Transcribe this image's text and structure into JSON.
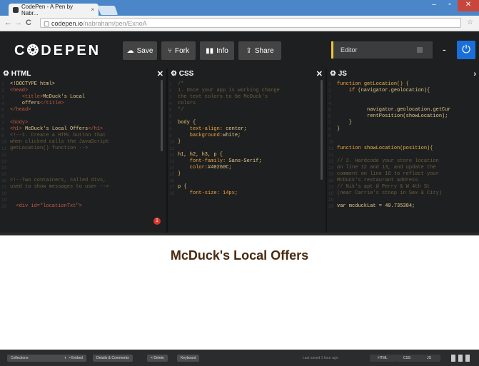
{
  "browser": {
    "tab_title": "CodePen - A Pen by Nabr...",
    "tab_close": "×",
    "url_host": "codepen.io",
    "url_path": "/nabraham/pen/ExnoA",
    "window_controls": [
      "–",
      "▫",
      "✕"
    ]
  },
  "header": {
    "logo": "C❂DEPEN",
    "save_label": "Save",
    "fork_label": "Fork",
    "info_label": "Info",
    "share_label": "Share",
    "editor_view": "Editor"
  },
  "panes": {
    "html": {
      "title": "HTML",
      "lines": [
        [
          {
            "c": "wh",
            "t": "<!DOCTYPE html>"
          }
        ],
        [
          {
            "c": "tag",
            "t": "<head>"
          }
        ],
        [
          {
            "c": "tag",
            "t": "    <title>"
          },
          {
            "c": "wh",
            "t": "McDuck's Local"
          }
        ],
        [
          {
            "c": "wh",
            "t": "    offers"
          },
          {
            "c": "tag",
            "t": "</title>"
          }
        ],
        [
          {
            "c": "tag",
            "t": "</head>"
          }
        ],
        [
          {
            "c": "wh",
            "t": ""
          }
        ],
        [
          {
            "c": "tag",
            "t": "<body>"
          }
        ],
        [
          {
            "c": "tag",
            "t": "<h1> "
          },
          {
            "c": "wh",
            "t": "McDuck's Local Offers"
          },
          {
            "c": "tag",
            "t": "</h1>"
          }
        ],
        [
          {
            "c": "cm",
            "t": "<!--1. Create a HTML button that"
          }
        ],
        [
          {
            "c": "cm",
            "t": "when clicked calls the JavaScript"
          }
        ],
        [
          {
            "c": "cm",
            "t": "getLocation() function -->"
          }
        ],
        [
          {
            "c": "wh",
            "t": ""
          }
        ],
        [
          {
            "c": "wh",
            "t": ""
          }
        ],
        [
          {
            "c": "wh",
            "t": ""
          }
        ],
        [
          {
            "c": "wh",
            "t": ""
          }
        ],
        [
          {
            "c": "cm",
            "t": "<!--Two containers, called divs,"
          }
        ],
        [
          {
            "c": "cm",
            "t": "used to show messages to user -->"
          }
        ],
        [
          {
            "c": "wh",
            "t": ""
          }
        ],
        [
          {
            "c": "wh",
            "t": ""
          }
        ],
        [
          {
            "c": "tag",
            "t": "  <div id=\"locationTxt\">"
          }
        ]
      ]
    },
    "css": {
      "title": "CSS",
      "lines": [
        [
          {
            "c": "cm",
            "t": "/*"
          }
        ],
        [
          {
            "c": "cm",
            "t": "1. Once your app is working change"
          }
        ],
        [
          {
            "c": "cm",
            "t": "the text colors to be McDuck's"
          }
        ],
        [
          {
            "c": "cm",
            "t": "colors"
          }
        ],
        [
          {
            "c": "cm",
            "t": "*/"
          }
        ],
        [
          {
            "c": "wh",
            "t": ""
          }
        ],
        [
          {
            "c": "txt",
            "t": "body {"
          }
        ],
        [
          {
            "c": "kw",
            "t": "    text-align: "
          },
          {
            "c": "wh",
            "t": "center;"
          }
        ],
        [
          {
            "c": "kw",
            "t": "    background:"
          },
          {
            "c": "wh",
            "t": "white;"
          }
        ],
        [
          {
            "c": "txt",
            "t": "}"
          }
        ],
        [
          {
            "c": "wh",
            "t": ""
          }
        ],
        [
          {
            "c": "txt",
            "t": "h1, h2, h3, p {"
          }
        ],
        [
          {
            "c": "kw",
            "t": "    font-family: "
          },
          {
            "c": "wh",
            "t": "Sans-Serif;"
          }
        ],
        [
          {
            "c": "kw",
            "t": "    color:"
          },
          {
            "c": "wh",
            "t": "#40260C;"
          }
        ],
        [
          {
            "c": "txt",
            "t": "}"
          }
        ],
        [
          {
            "c": "wh",
            "t": ""
          }
        ],
        [
          {
            "c": "txt",
            "t": "p {"
          }
        ],
        [
          {
            "c": "kw",
            "t": "    font-size: 14px;"
          }
        ]
      ]
    },
    "js": {
      "title": "JS",
      "lines": [
        [
          {
            "c": "kw",
            "t": "function "
          },
          {
            "c": "fn",
            "t": "getLocation() {"
          }
        ],
        [
          {
            "c": "kw",
            "t": "    if "
          },
          {
            "c": "wh",
            "t": "(navigator.geolocation){"
          }
        ],
        [
          {
            "c": "wh",
            "t": ""
          }
        ],
        [
          {
            "c": "wh",
            "t": ""
          }
        ],
        [
          {
            "c": "wh",
            "t": "          navigator.geolocation.getCur"
          }
        ],
        [
          {
            "c": "wh",
            "t": "          rentPosition(showLocation);"
          }
        ],
        [
          {
            "c": "wh",
            "t": "    }"
          }
        ],
        [
          {
            "c": "wh",
            "t": "}"
          }
        ],
        [
          {
            "c": "wh",
            "t": ""
          }
        ],
        [
          {
            "c": "wh",
            "t": ""
          }
        ],
        [
          {
            "c": "kw",
            "t": "function "
          },
          {
            "c": "fn",
            "t": "showLocation(position){"
          }
        ],
        [
          {
            "c": "wh",
            "t": ""
          }
        ],
        [
          {
            "c": "cm",
            "t": "// 2. Hardcode your store location"
          }
        ],
        [
          {
            "c": "cm",
            "t": "on line 12 and 13, and update the"
          }
        ],
        [
          {
            "c": "cm",
            "t": "comment on line 16 to reflect your"
          }
        ],
        [
          {
            "c": "cm",
            "t": "McDuck's restaurant address"
          }
        ],
        [
          {
            "c": "cm",
            "t": "// Nik's apt @ Perry & W 4th St"
          }
        ],
        [
          {
            "c": "cm",
            "t": "(near Carrie's stoop in Sex & City)"
          }
        ],
        [
          {
            "c": "wh",
            "t": ""
          }
        ],
        [
          {
            "c": "wh",
            "t": "var mcduckLat = 40.735384;"
          }
        ]
      ]
    }
  },
  "error_count": "1",
  "preview": {
    "heading": "McDuck's Local Offers"
  },
  "footer": {
    "collections_label": "Collections",
    "embed_label": "Embed",
    "details_label": "Details & Comments",
    "delete_label": "Delete",
    "keyboard_label": "Keyboard",
    "status": "Last saved 1 hour ago",
    "html_label": "HTML",
    "css_label": "CSS",
    "js_label": "JS"
  },
  "colors": {
    "accent": "#f3c52f",
    "brand_blue": "#1a6ed8",
    "heading": "#40260C"
  }
}
